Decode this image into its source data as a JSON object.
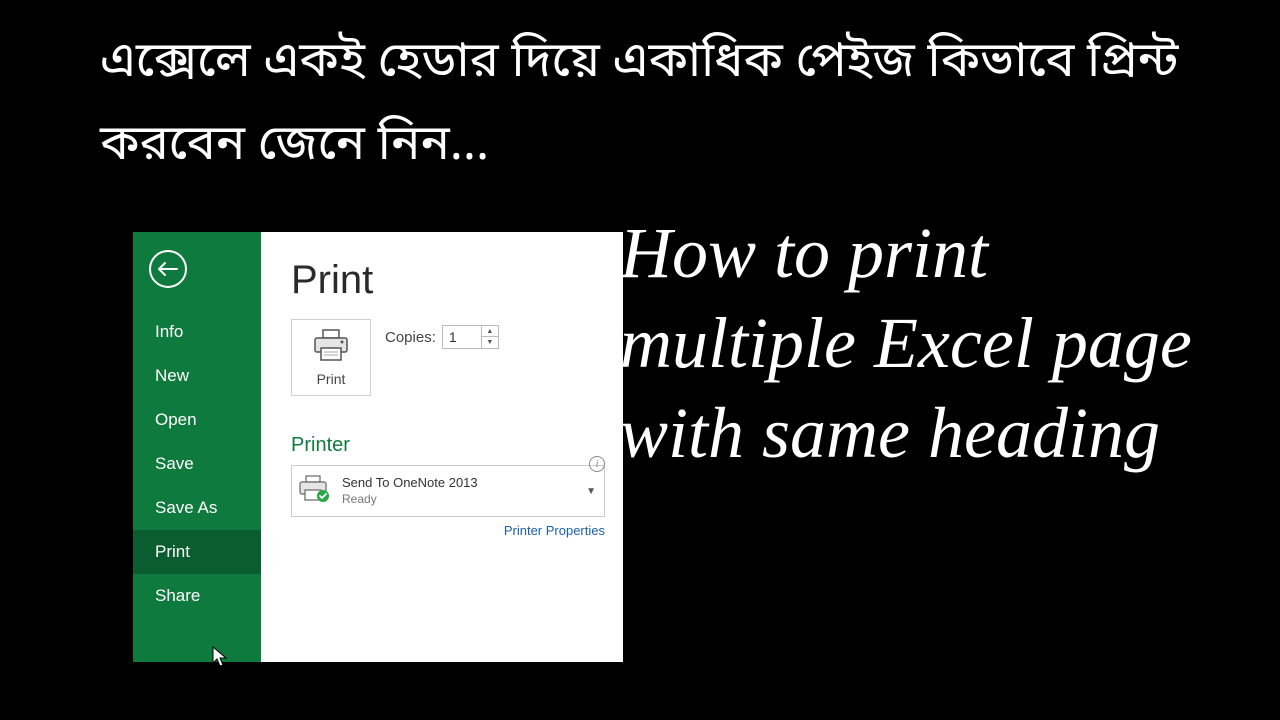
{
  "title_bengali": "এক্সেলে একই হেডার দিয়ে একাধিক পেইজ কিভাবে প্রিন্ট করবেন জেনে নিন...",
  "title_english": "How to print multiple Excel page with same heading",
  "excel": {
    "menu": {
      "info": "Info",
      "new": "New",
      "open": "Open",
      "save": "Save",
      "save_as": "Save As",
      "print": "Print",
      "share": "Share"
    },
    "page_title": "Print",
    "print_button_label": "Print",
    "copies_label": "Copies:",
    "copies_value": "1",
    "printer_section": "Printer",
    "printer": {
      "name": "Send To OneNote 2013",
      "status": "Ready"
    },
    "printer_properties": "Printer Properties"
  }
}
